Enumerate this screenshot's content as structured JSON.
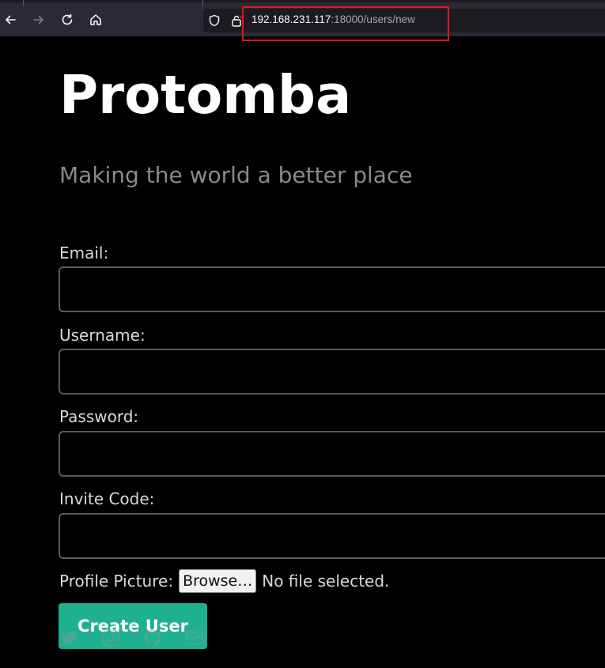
{
  "browser": {
    "url_host": "192.168.231.117",
    "url_rest": ":18000/users/new"
  },
  "header": {
    "title": "Protomba",
    "tagline": "Making the world a better place"
  },
  "form": {
    "email_label": "Email:",
    "username_label": "Username:",
    "password_label": "Password:",
    "invite_label": "Invite Code:",
    "email_value": "",
    "username_value": "",
    "password_value": "",
    "invite_value": "",
    "picture_label": "Profile Picture:",
    "browse_label": "Browse…",
    "file_status": "No file selected.",
    "submit_label": "Create User"
  },
  "footer": {
    "icons": [
      "twitter-icon",
      "instagram-icon",
      "github-icon",
      "mail-icon"
    ]
  },
  "colors": {
    "accent": "#1fb08f",
    "highlight": "#e0161c",
    "background": "#000000"
  }
}
